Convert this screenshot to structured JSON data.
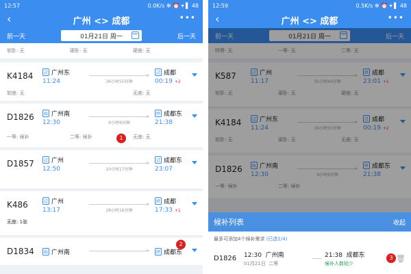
{
  "colors": {
    "primary": "#3b8df0",
    "alert": "#d9221f",
    "waitlist": "#f08c2a"
  },
  "left": {
    "status": {
      "time": "12:57",
      "right": "0.0K/s ✻ ⏰ ▾ ▌ 48"
    },
    "title": "广州 <> 成都",
    "prev_day": "前一天",
    "next_day": "后一天",
    "date": "01月21日 周一",
    "top_seats": [
      "软卧: 无",
      "硬卧: 无",
      "硬座: 无"
    ],
    "trains": [
      {
        "no": "K4184",
        "from_tag": "过",
        "from": "广州东",
        "dep": "11:24",
        "duration": "36小时55分钟",
        "to_tag": "过",
        "to": "成都",
        "arr": "00:19",
        "plus": "+2",
        "seats": [
          "软座: 无",
          "",
          "无座: 无"
        ]
      },
      {
        "no": "D1826",
        "from_tag": "始",
        "from": "广州南",
        "dep": "12:30",
        "duration": "9小时8分钟",
        "to_tag": "终",
        "to": "成都东",
        "arr": "21:38",
        "plus": "",
        "seats": [
          "一等: 候补",
          "二等: 候补",
          "无座: 无"
        ],
        "badge": "1"
      },
      {
        "no": "D1857",
        "from_tag": "过",
        "from": "广州",
        "dep": "12:50",
        "duration": "10小时17分钟",
        "to_tag": "过",
        "to": "成都东",
        "arr": "23:07",
        "plus": "",
        "seats": []
      },
      {
        "no": "K486",
        "from_tag": "过",
        "from": "广州",
        "dep": "13:17",
        "duration": "28小时16分钟",
        "to_tag": "终",
        "to": "成都",
        "arr": "17:33",
        "plus": "+1",
        "seats": [
          "无座: 1张"
        ]
      },
      {
        "no": "D1834",
        "from_tag": "始",
        "from": "广州南",
        "dep": "",
        "duration": "",
        "to_tag": "终",
        "to": "成都东",
        "arr": "",
        "plus": "",
        "badge": "2",
        "seats": []
      }
    ]
  },
  "right": {
    "status": {
      "time": "12:59",
      "right": "0.5K/s ✻ ⏰ ▾ ▌ 48"
    },
    "title": "广州 <> 成都",
    "prev_day": "前一天",
    "next_day": "后一天",
    "date": "01月21日 周一",
    "top_seats": [
      "特等: 无",
      "一等: 无",
      "二等: 无"
    ],
    "trains": [
      {
        "no": "K587",
        "from_tag": "过",
        "from": "广州",
        "dep": "11:17",
        "duration": "35小时44分钟",
        "to_tag": "终",
        "to": "成都",
        "arr": "23:01",
        "plus": "+1",
        "seats": [
          "软卧: 无",
          "硬卧: 无",
          "硬座: 无"
        ]
      },
      {
        "no": "K4184",
        "from_tag": "过",
        "from": "广州东",
        "dep": "11:24",
        "duration": "36小时55分钟",
        "to_tag": "过",
        "to": "成都",
        "arr": "00:19",
        "plus": "+2",
        "seats": [
          "软卧: 无",
          "硬卧: 无",
          "无座: 无"
        ]
      },
      {
        "no": "D1826",
        "from_tag": "始",
        "from": "广州南",
        "dep": "12:30",
        "duration": "9小时8分钟",
        "to_tag": "终",
        "to": "成都东",
        "arr": "21:38",
        "plus": "",
        "seats": [
          "一等: 候补",
          "二等: 候补"
        ]
      }
    ],
    "waitlist": {
      "title": "候补列表",
      "collapse": "收起",
      "note": "最多可添加4个候补需求",
      "count": "(已选1/4)",
      "item": {
        "no": "D1826",
        "dep": "12:30",
        "from": "广州南",
        "arr": "21:38",
        "to": "成都东",
        "date": "01月21日",
        "seat": "二等",
        "status": "候补人数较少",
        "badge": "3"
      }
    }
  }
}
